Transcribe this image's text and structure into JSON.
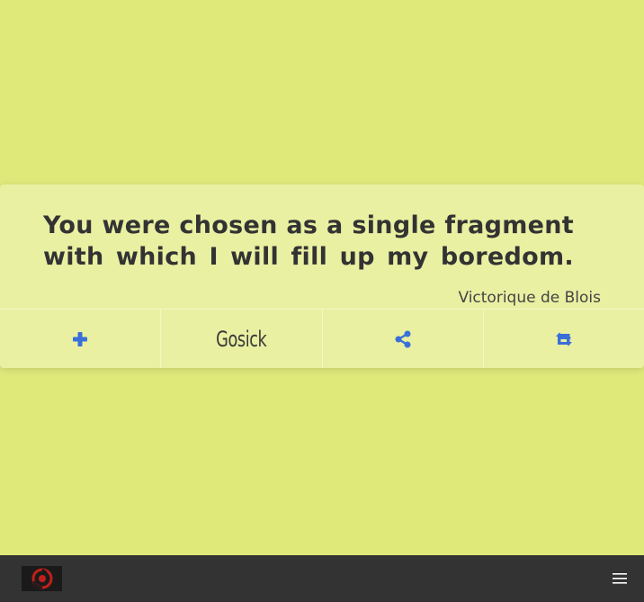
{
  "quote": {
    "text": "You were chosen as a single fragment with which I will fill up my boredom.",
    "author": "Victorique de Blois"
  },
  "actions": {
    "add_icon": "plus-icon",
    "source": "Gosick",
    "share_icon": "share-icon",
    "refresh_icon": "retweet-icon"
  },
  "footer": {
    "logo_icon": "logo-icon",
    "menu_icon": "hamburger-menu-icon"
  },
  "colors": {
    "background": "#dee97a",
    "card": "#e9f0a2",
    "text": "#333333",
    "accent": "#3a6fd8",
    "footer": "#333333"
  }
}
